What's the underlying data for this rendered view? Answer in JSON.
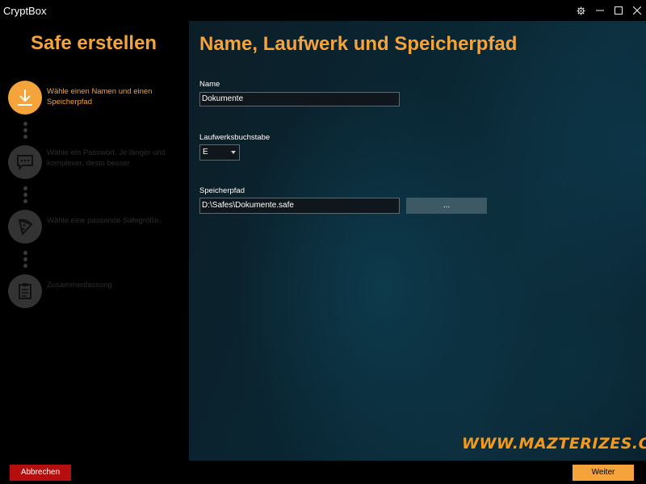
{
  "window": {
    "title": "CryptBox",
    "controls": [
      "gear-icon",
      "minimize-icon",
      "maximize-icon",
      "close-icon"
    ]
  },
  "sidebar": {
    "title": "Safe erstellen",
    "steps": [
      {
        "icon": "download-icon",
        "label": "Wähle einen Namen und einen Speicherpfad",
        "active": true
      },
      {
        "icon": "chat-icon",
        "label": "Wähle ein Passwort. Je länger und komplexer, desto besser",
        "active": false
      },
      {
        "icon": "pizza-icon",
        "label": "Wähle eine passende Safegröße.",
        "active": false
      },
      {
        "icon": "clipboard-icon",
        "label": "Zusammenfassung",
        "active": false
      }
    ]
  },
  "main": {
    "title": "Name, Laufwerk und Speicherpfad",
    "name_label": "Name",
    "name_value": "Dokumente",
    "drive_label": "Laufwerksbuchstabe",
    "drive_value": "E",
    "path_label": "Speicherpfad",
    "path_value": "D:\\Safes\\Dokumente.safe",
    "browse_label": "...",
    "watermark": "WWW.MAZTERIZES.COM"
  },
  "footer": {
    "cancel_label": "Abbrechen",
    "next_label": "Weiter"
  },
  "colors": {
    "accent": "#f4a43a",
    "cancel": "#b50e0e",
    "panel": "#0a2633"
  }
}
